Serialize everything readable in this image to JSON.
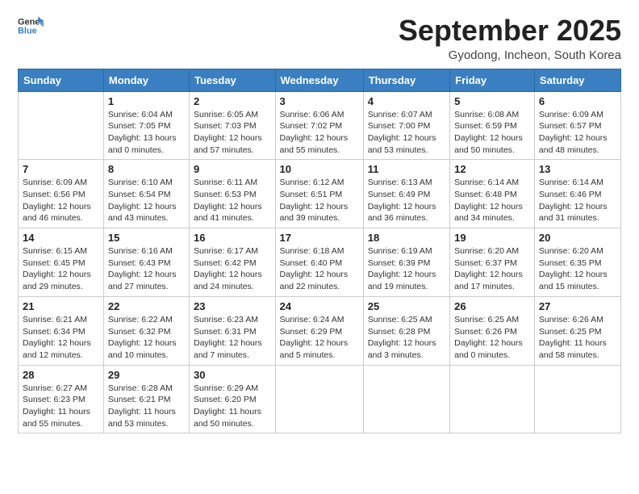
{
  "logo": {
    "line1": "General",
    "line2": "Blue"
  },
  "title": "September 2025",
  "subtitle": "Gyodong, Incheon, South Korea",
  "days_header": [
    "Sunday",
    "Monday",
    "Tuesday",
    "Wednesday",
    "Thursday",
    "Friday",
    "Saturday"
  ],
  "weeks": [
    [
      {
        "day": "",
        "info": ""
      },
      {
        "day": "1",
        "info": "Sunrise: 6:04 AM\nSunset: 7:05 PM\nDaylight: 13 hours\nand 0 minutes."
      },
      {
        "day": "2",
        "info": "Sunrise: 6:05 AM\nSunset: 7:03 PM\nDaylight: 12 hours\nand 57 minutes."
      },
      {
        "day": "3",
        "info": "Sunrise: 6:06 AM\nSunset: 7:02 PM\nDaylight: 12 hours\nand 55 minutes."
      },
      {
        "day": "4",
        "info": "Sunrise: 6:07 AM\nSunset: 7:00 PM\nDaylight: 12 hours\nand 53 minutes."
      },
      {
        "day": "5",
        "info": "Sunrise: 6:08 AM\nSunset: 6:59 PM\nDaylight: 12 hours\nand 50 minutes."
      },
      {
        "day": "6",
        "info": "Sunrise: 6:09 AM\nSunset: 6:57 PM\nDaylight: 12 hours\nand 48 minutes."
      }
    ],
    [
      {
        "day": "7",
        "info": "Sunrise: 6:09 AM\nSunset: 6:56 PM\nDaylight: 12 hours\nand 46 minutes."
      },
      {
        "day": "8",
        "info": "Sunrise: 6:10 AM\nSunset: 6:54 PM\nDaylight: 12 hours\nand 43 minutes."
      },
      {
        "day": "9",
        "info": "Sunrise: 6:11 AM\nSunset: 6:53 PM\nDaylight: 12 hours\nand 41 minutes."
      },
      {
        "day": "10",
        "info": "Sunrise: 6:12 AM\nSunset: 6:51 PM\nDaylight: 12 hours\nand 39 minutes."
      },
      {
        "day": "11",
        "info": "Sunrise: 6:13 AM\nSunset: 6:49 PM\nDaylight: 12 hours\nand 36 minutes."
      },
      {
        "day": "12",
        "info": "Sunrise: 6:14 AM\nSunset: 6:48 PM\nDaylight: 12 hours\nand 34 minutes."
      },
      {
        "day": "13",
        "info": "Sunrise: 6:14 AM\nSunset: 6:46 PM\nDaylight: 12 hours\nand 31 minutes."
      }
    ],
    [
      {
        "day": "14",
        "info": "Sunrise: 6:15 AM\nSunset: 6:45 PM\nDaylight: 12 hours\nand 29 minutes."
      },
      {
        "day": "15",
        "info": "Sunrise: 6:16 AM\nSunset: 6:43 PM\nDaylight: 12 hours\nand 27 minutes."
      },
      {
        "day": "16",
        "info": "Sunrise: 6:17 AM\nSunset: 6:42 PM\nDaylight: 12 hours\nand 24 minutes."
      },
      {
        "day": "17",
        "info": "Sunrise: 6:18 AM\nSunset: 6:40 PM\nDaylight: 12 hours\nand 22 minutes."
      },
      {
        "day": "18",
        "info": "Sunrise: 6:19 AM\nSunset: 6:39 PM\nDaylight: 12 hours\nand 19 minutes."
      },
      {
        "day": "19",
        "info": "Sunrise: 6:20 AM\nSunset: 6:37 PM\nDaylight: 12 hours\nand 17 minutes."
      },
      {
        "day": "20",
        "info": "Sunrise: 6:20 AM\nSunset: 6:35 PM\nDaylight: 12 hours\nand 15 minutes."
      }
    ],
    [
      {
        "day": "21",
        "info": "Sunrise: 6:21 AM\nSunset: 6:34 PM\nDaylight: 12 hours\nand 12 minutes."
      },
      {
        "day": "22",
        "info": "Sunrise: 6:22 AM\nSunset: 6:32 PM\nDaylight: 12 hours\nand 10 minutes."
      },
      {
        "day": "23",
        "info": "Sunrise: 6:23 AM\nSunset: 6:31 PM\nDaylight: 12 hours\nand 7 minutes."
      },
      {
        "day": "24",
        "info": "Sunrise: 6:24 AM\nSunset: 6:29 PM\nDaylight: 12 hours\nand 5 minutes."
      },
      {
        "day": "25",
        "info": "Sunrise: 6:25 AM\nSunset: 6:28 PM\nDaylight: 12 hours\nand 3 minutes."
      },
      {
        "day": "26",
        "info": "Sunrise: 6:25 AM\nSunset: 6:26 PM\nDaylight: 12 hours\nand 0 minutes."
      },
      {
        "day": "27",
        "info": "Sunrise: 6:26 AM\nSunset: 6:25 PM\nDaylight: 11 hours\nand 58 minutes."
      }
    ],
    [
      {
        "day": "28",
        "info": "Sunrise: 6:27 AM\nSunset: 6:23 PM\nDaylight: 11 hours\nand 55 minutes."
      },
      {
        "day": "29",
        "info": "Sunrise: 6:28 AM\nSunset: 6:21 PM\nDaylight: 11 hours\nand 53 minutes."
      },
      {
        "day": "30",
        "info": "Sunrise: 6:29 AM\nSunset: 6:20 PM\nDaylight: 11 hours\nand 50 minutes."
      },
      {
        "day": "",
        "info": ""
      },
      {
        "day": "",
        "info": ""
      },
      {
        "day": "",
        "info": ""
      },
      {
        "day": "",
        "info": ""
      }
    ]
  ]
}
